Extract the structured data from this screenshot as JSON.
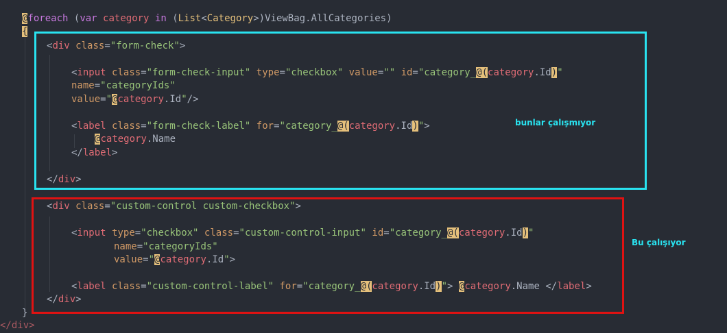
{
  "code": {
    "line1": {
      "at": "@",
      "kw_foreach": "foreach",
      "paren_open": " (",
      "kw_var": "var",
      "sp1": " ",
      "var_category": "category",
      "sp2": " ",
      "kw_in": "in",
      "paren2": " (",
      "type_list": "List",
      "lt": "<",
      "type_category": "Category",
      "gt": ">)",
      "viewbag": "ViewBag.AllCategories)"
    },
    "line2": {
      "brace_open": "{"
    },
    "div1_open": {
      "lt": "<",
      "tag": "div",
      "sp": " ",
      "attr": "class",
      "eq": "=",
      "val": "\"form-check\"",
      "gt": ">"
    },
    "input1": {
      "lt": "<",
      "tag": "input",
      "a1": "class",
      "v1": "\"form-check-input\"",
      "a2": "type",
      "v2": "\"checkbox\"",
      "a3": "value",
      "v3": "\"\"",
      "a4": "id",
      "v4a": "\"category_",
      "v4b": "category",
      "v4c": ".Id",
      "v4d": "\""
    },
    "input1_name": {
      "attr": "name",
      "val": "\"categoryIds\""
    },
    "input1_value": {
      "attr": "value",
      "q1": "\"",
      "var": "category",
      "prop": ".Id",
      "q2": "\"",
      "end": "/>"
    },
    "label1": {
      "lt": "<",
      "tag": "label",
      "a1": "class",
      "v1": "\"form-check-label\"",
      "a2": "for",
      "v2a": "\"category_",
      "v2b": "category",
      "v2c": ".Id",
      "v2d": "\"",
      "gt": ">"
    },
    "label1_body": {
      "var": "category",
      "prop": ".Name"
    },
    "label1_close": {
      "lt": "</",
      "tag": "label",
      "gt": ">"
    },
    "div1_close": {
      "lt": "</",
      "tag": "div",
      "gt": ">"
    },
    "div2_open": {
      "lt": "<",
      "tag": "div",
      "attr": "class",
      "val": "\"custom-control custom-checkbox\"",
      "gt": ">"
    },
    "input2": {
      "lt": "<",
      "tag": "input",
      "a1": "type",
      "v1": "\"checkbox\"",
      "a2": "class",
      "v2": "\"custom-control-input\"",
      "a3": "id",
      "v3a": "\"category_",
      "v3b": "category",
      "v3c": ".Id",
      "v3d": "\""
    },
    "input2_name": {
      "attr": "name",
      "val": "\"categoryIds\""
    },
    "input2_value": {
      "attr": "value",
      "q1": "\"",
      "var": "category",
      "prop": ".Id",
      "q2": "\"",
      "gt": ">"
    },
    "label2": {
      "lt": "<",
      "tag": "label",
      "a1": "class",
      "v1": "\"custom-control-label\"",
      "a2": "for",
      "v2a": "\"category_",
      "v2b": "category",
      "v2c": ".Id",
      "v2d": "\"",
      "gt": ">",
      "var": "category",
      "prop": ".Name",
      "close_lt": "</",
      "close_tag": "label",
      "close_gt": ">"
    },
    "div2_close": {
      "lt": "</",
      "tag": "div",
      "gt": ">"
    },
    "brace_close": "}",
    "last_line": "</div>"
  },
  "annotations": {
    "cyan_note": "bunlar çalışmıyor",
    "red_note": "Bu çalışıyor"
  },
  "colors": {
    "cyan_box": "#29e3f0",
    "red_box": "#e01212",
    "cyan_text": "#29e3f0",
    "red_text": "#29e3f0"
  }
}
